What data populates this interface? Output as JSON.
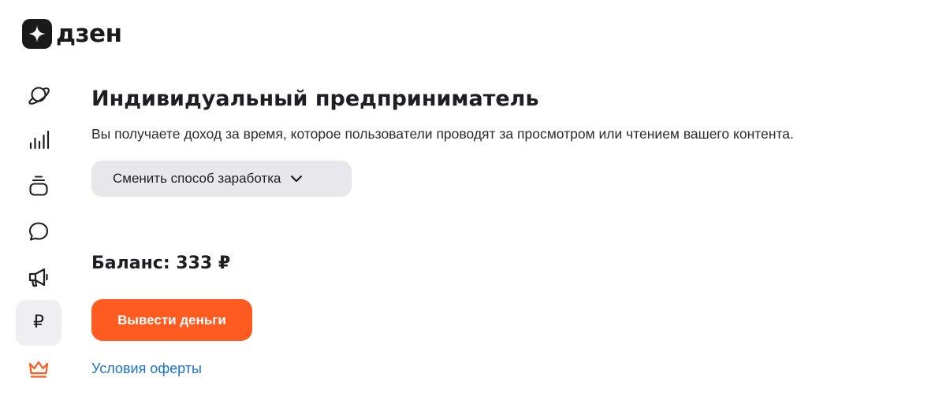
{
  "brand": {
    "logo_text": "дзен",
    "accent_color": "#ff5a1f",
    "link_color": "#1a73c8"
  },
  "sidebar": {
    "items": [
      {
        "icon": "planet-icon",
        "active": false
      },
      {
        "icon": "stats-bars-icon",
        "active": false
      },
      {
        "icon": "content-stack-icon",
        "active": false
      },
      {
        "icon": "comment-bubble-icon",
        "active": false
      },
      {
        "icon": "megaphone-icon",
        "active": false
      },
      {
        "icon": "ruble-icon",
        "label": "₽",
        "active": true
      },
      {
        "icon": "crown-icon",
        "active": false
      }
    ]
  },
  "main": {
    "title": "Индивидуальный предприниматель",
    "subtitle": "Вы получаете доход за время, которое пользователи проводят за просмотром или чтением вашего контента.",
    "switch_button_label": "Сменить способ заработка",
    "balance": "Баланс: 333 ₽",
    "withdraw_button_label": "Вывести деньги",
    "offer_link_label": "Условия оферты"
  }
}
